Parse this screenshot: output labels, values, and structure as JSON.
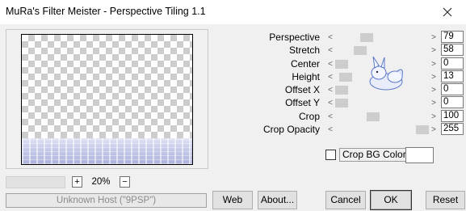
{
  "window": {
    "title": "MuRa's Filter Meister - Perspective Tiling 1.1",
    "close_glyph": "✕"
  },
  "zoom": {
    "plus": "+",
    "minus": "−",
    "value": "20%"
  },
  "status": {
    "text": "Unknown Host (\"9PSP\")"
  },
  "parameters": [
    {
      "label": "Perspective",
      "value": "79",
      "level": 79
    },
    {
      "label": "Stretch",
      "value": "58",
      "level": 58
    },
    {
      "label": "Center",
      "value": "0",
      "level": 0
    },
    {
      "label": "Height",
      "value": "13",
      "level": 13
    },
    {
      "label": "Offset X",
      "value": "0",
      "level": 0
    },
    {
      "label": "Offset Y",
      "value": "0",
      "level": 0
    },
    {
      "label": "Crop",
      "value": "100",
      "level": 100
    },
    {
      "label": "Crop Opacity",
      "value": "255",
      "level": 255
    }
  ],
  "slider_arrows": {
    "left": "<",
    "right": ">"
  },
  "crop_bg": {
    "label": "Crop BG Color",
    "checked": false,
    "swatch_color": "#ffffff"
  },
  "buttons": {
    "web": "Web",
    "about": "About...",
    "cancel": "Cancel",
    "ok": "OK",
    "reset": "Reset"
  },
  "colors": {
    "background": "#f0f0f0",
    "thumb": "#cdcdcd",
    "tile_blue": "#aeb3dc"
  }
}
